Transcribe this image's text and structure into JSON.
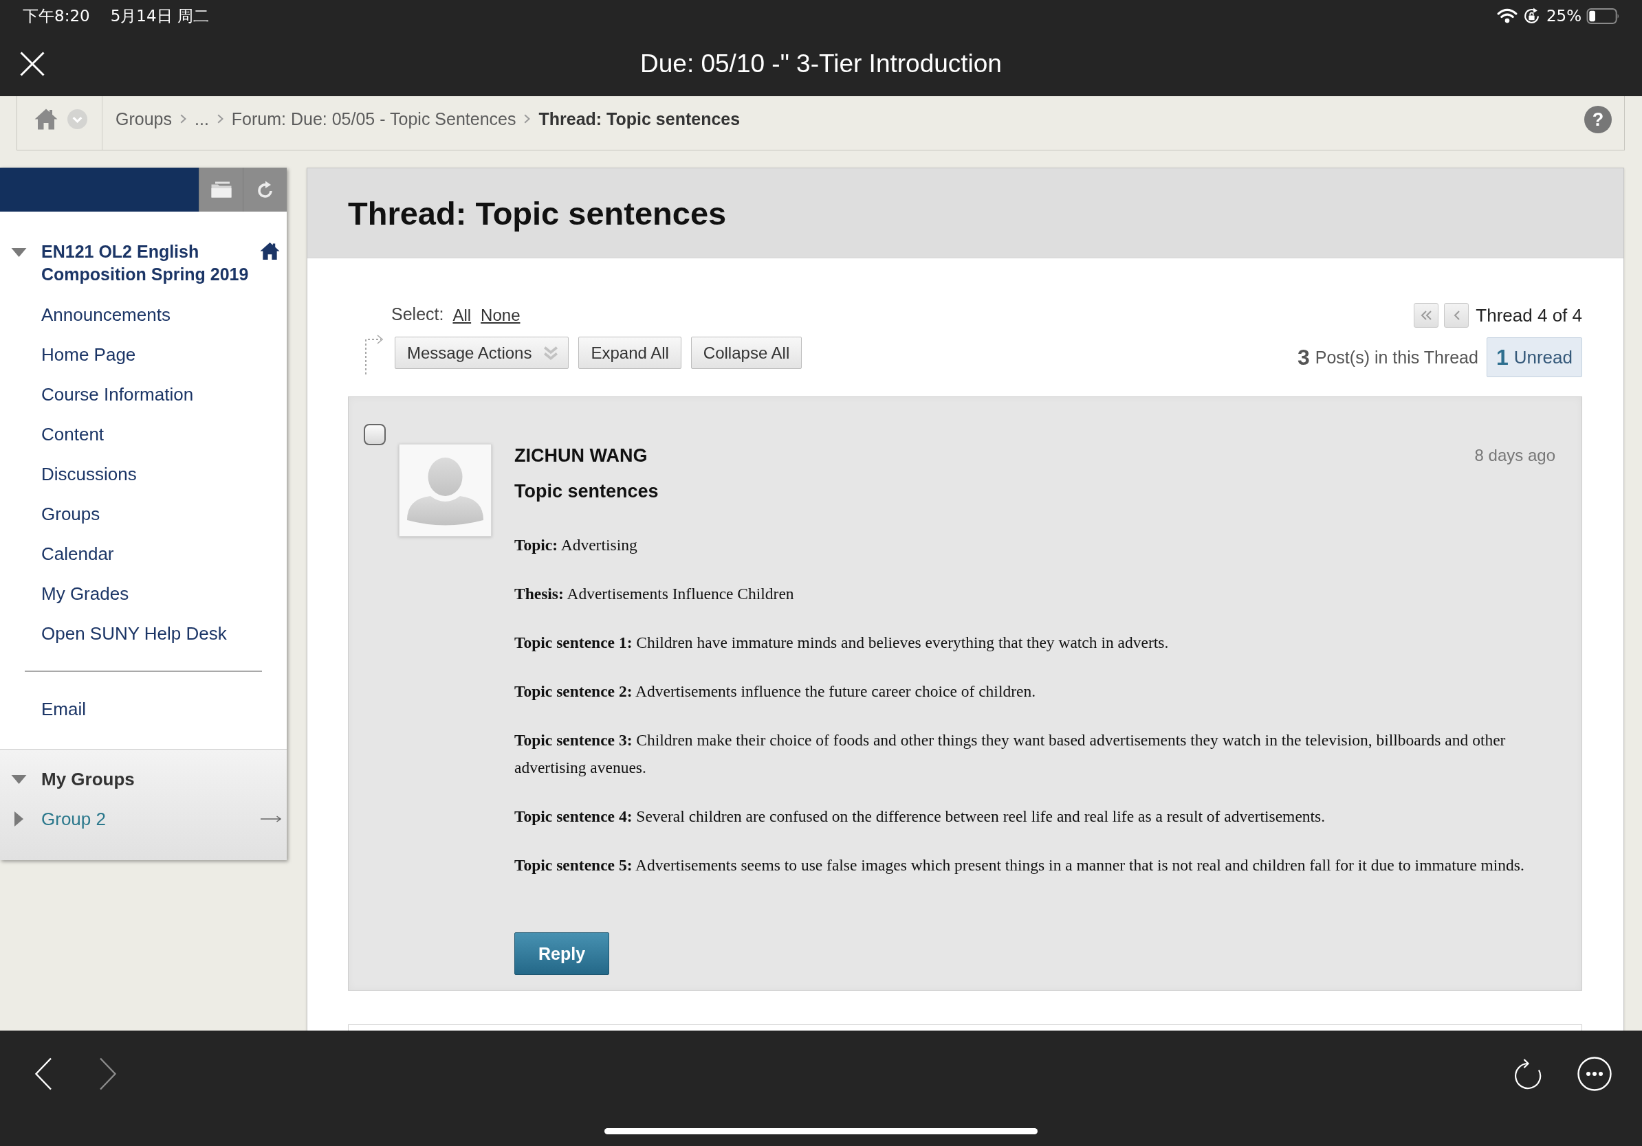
{
  "status_bar": {
    "time": "下午8:20",
    "date": "5月14日 周二",
    "battery": "25%"
  },
  "title_bar": {
    "title": "Due: 05/10 -\" 3-Tier Introduction"
  },
  "breadcrumb": {
    "items": [
      {
        "label": "Groups",
        "current": false
      },
      {
        "label": "...",
        "current": false
      },
      {
        "label": "Forum: Due: 05/05 - Topic Sentences",
        "current": false
      },
      {
        "label": "Thread: Topic sentences",
        "current": true
      }
    ],
    "help": "?"
  },
  "sidebar": {
    "course": {
      "title": "EN121 OL2 English Composition Spring 2019",
      "expanded": true
    },
    "items": [
      "Announcements",
      "Home Page",
      "Course Information",
      "Content",
      "Discussions",
      "Groups",
      "Calendar",
      "My Grades",
      "Open SUNY Help Desk"
    ],
    "extra_items": [
      "Email"
    ],
    "my_groups": {
      "title": "My Groups",
      "expanded": true,
      "groups": [
        {
          "label": "Group 2",
          "expanded": false
        }
      ]
    }
  },
  "thread": {
    "title": "Thread: Topic sentences",
    "select": {
      "label": "Select:",
      "options": [
        "All",
        "None"
      ]
    },
    "actions": [
      {
        "label": "Message Actions",
        "kind": "menu"
      },
      {
        "label": "Expand All",
        "kind": "button"
      },
      {
        "label": "Collapse All",
        "kind": "button"
      }
    ],
    "pager": {
      "label": "Thread 4 of 4"
    },
    "post_count": "3",
    "post_count_label": "Post(s) in this Thread",
    "unread_count": "1",
    "unread_label": "Unread",
    "posts": [
      {
        "checked": false,
        "author": "ZICHUN WANG",
        "subject": "Topic sentences",
        "time": "8 days ago",
        "paragraphs": [
          "**Topic:** Advertising",
          "**Thesis:** Advertisements Influence Children",
          "**Topic sentence 1:** Children have immature minds and believes everything that they watch in adverts.",
          "**Topic sentence 2:** Advertisements influence the future career choice of children.",
          "**Topic sentence 3:** Children make their choice of foods and other things they want based advertisements they watch in the television, billboards and other advertising avenues.",
          "**Topic sentence 4:** Several children are confused on the difference between reel life and real life as a result of advertisements.",
          "**Topic sentence 5:** Advertisements seems to use false images which present things in a manner that is not real and children fall for it due to immature minds."
        ],
        "reply": "Reply"
      }
    ]
  },
  "browser_toolbar": {
    "left": [
      {
        "kind": "back",
        "disabled": false
      },
      {
        "kind": "forward",
        "disabled": true
      }
    ],
    "right": [
      {
        "kind": "reload",
        "disabled": false
      },
      {
        "kind": "more",
        "disabled": false
      }
    ]
  }
}
